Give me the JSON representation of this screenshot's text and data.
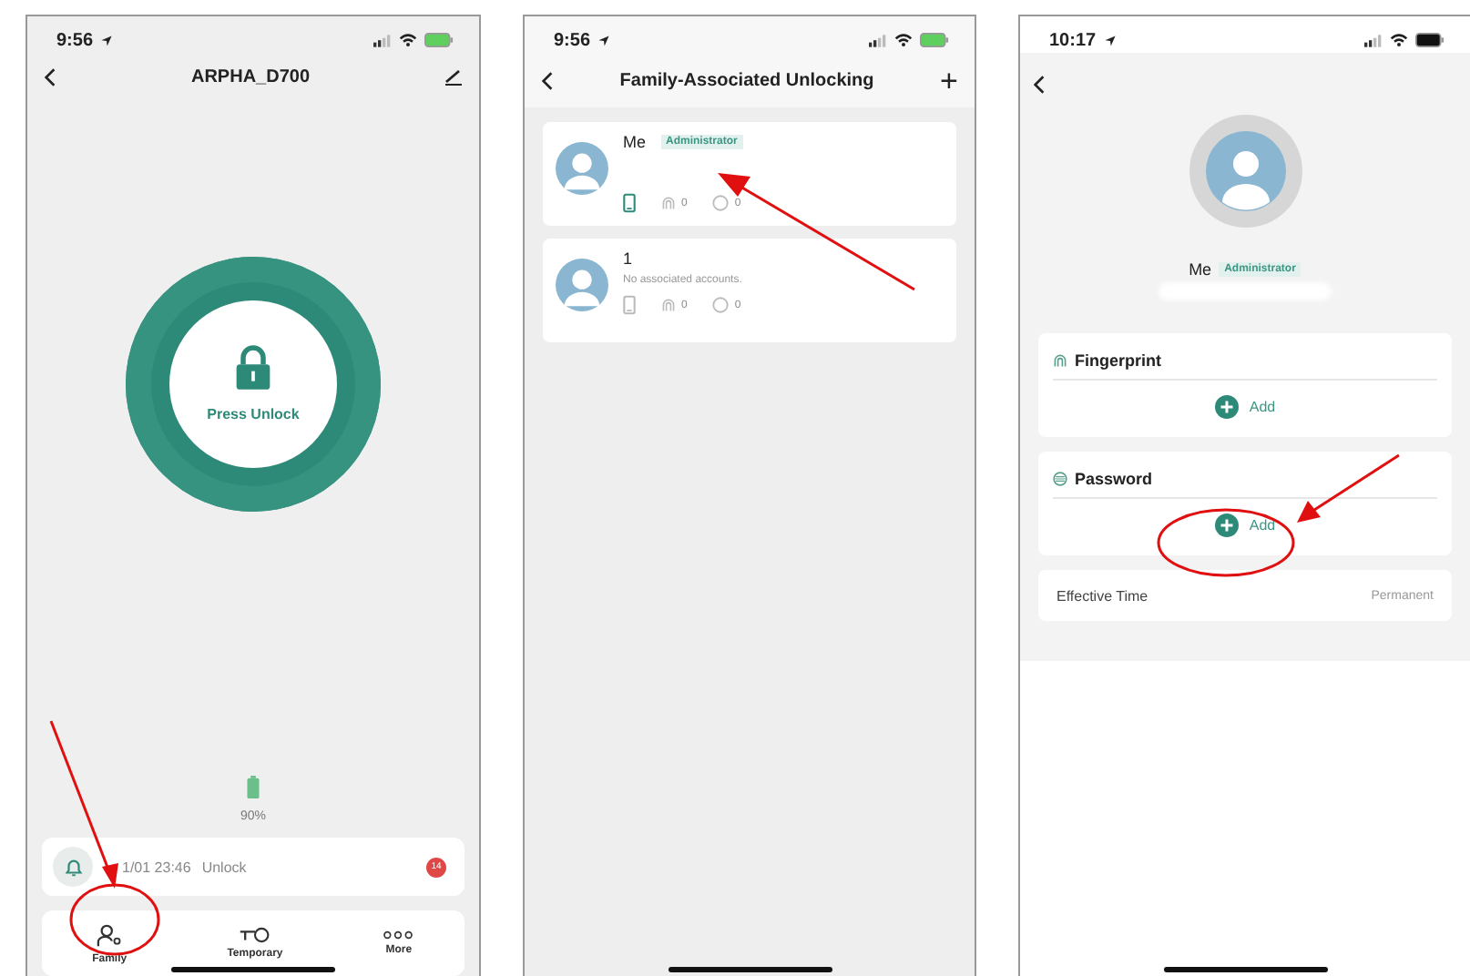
{
  "screens": [
    {
      "kind": "lock",
      "status_time": "9:56",
      "title": "ARPHA_D700",
      "unlock_label": "Press Unlock",
      "battery_percent": "90%",
      "log": {
        "time": "1/01 23:46",
        "event": "Unlock",
        "badge": "14"
      },
      "nav": [
        {
          "kind": "family",
          "label": "Family"
        },
        {
          "kind": "key",
          "label": "Temporary"
        },
        {
          "kind": "more",
          "label": "More"
        }
      ]
    },
    {
      "kind": "members",
      "status_time": "9:56",
      "title": "Family-Associated Unlocking",
      "add_icon": "+",
      "members": [
        {
          "name": "Me",
          "role": "Administrator",
          "phone_linked": true,
          "fingerprints": "0",
          "cards": "0"
        },
        {
          "name": "1",
          "note": "No associated accounts.",
          "phone_linked": false,
          "fingerprints": "0",
          "cards": "0"
        }
      ]
    },
    {
      "kind": "detail",
      "status_time": "10:17",
      "name": "Me",
      "role": "Administrator",
      "sections": [
        {
          "kind": "fingerprint",
          "title": "Fingerprint",
          "action": "Add"
        },
        {
          "kind": "password",
          "title": "Password",
          "action": "Add"
        }
      ],
      "effective": {
        "label": "Effective Time",
        "value": "Permanent"
      }
    }
  ]
}
